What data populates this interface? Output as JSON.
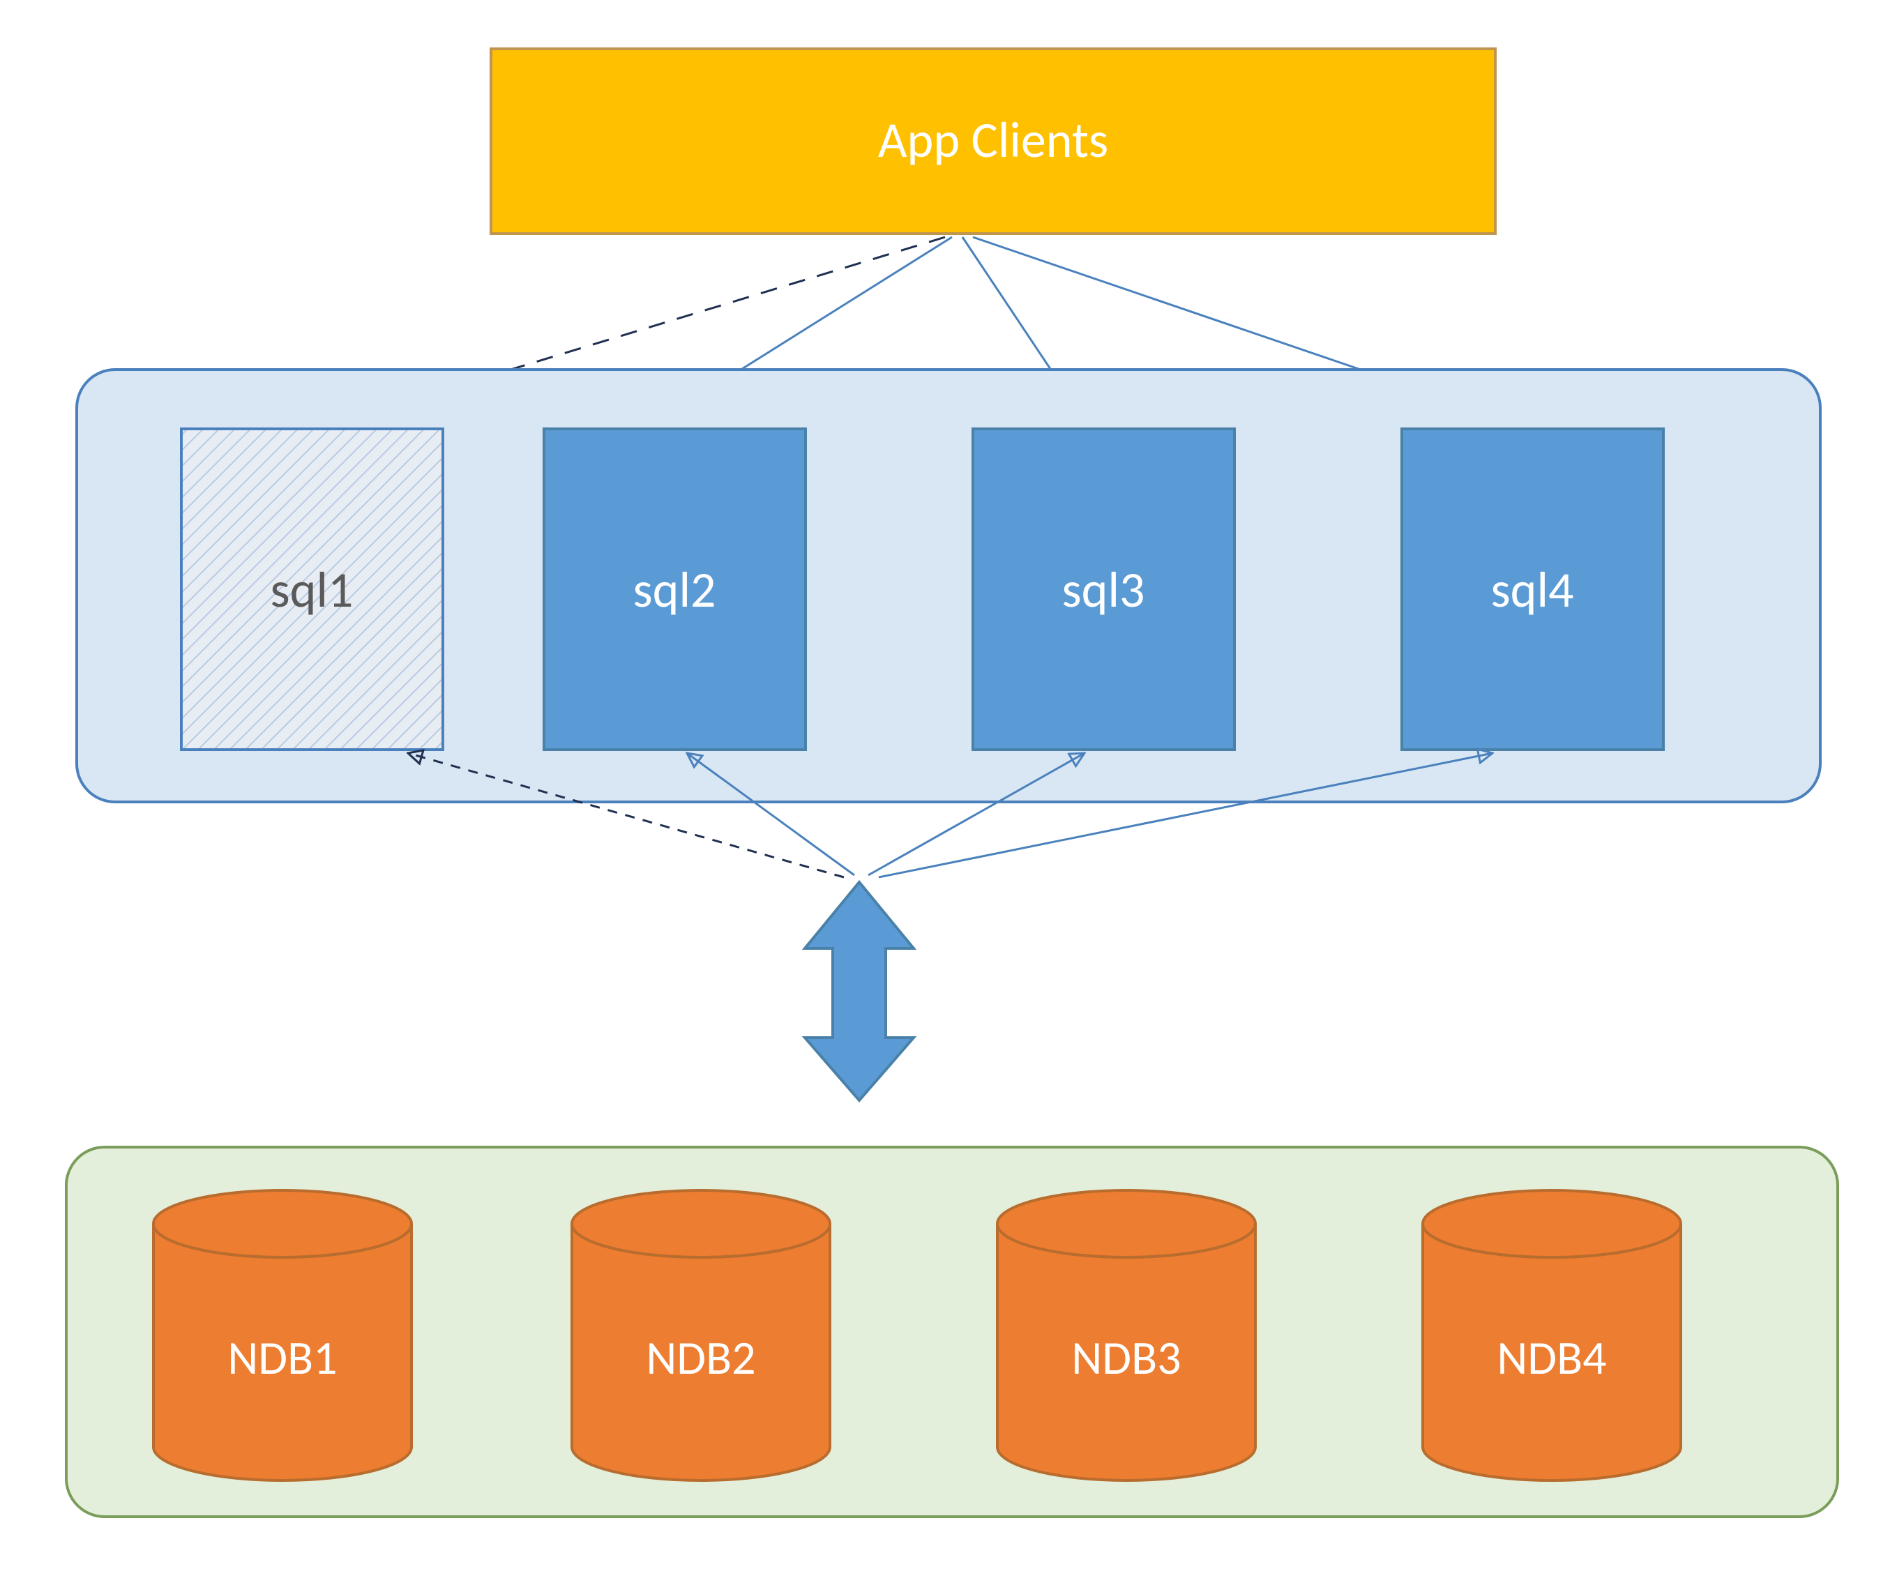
{
  "colors": {
    "yellow_fill": "#ffc000",
    "yellow_stroke": "#c0954d",
    "blue_container_fill": "#d9e6f4",
    "blue_container_stroke": "#4a81bd",
    "blue_node_fill": "#5b9bd5",
    "blue_node_stroke": "#4a81a8",
    "green_container_fill": "#e4efdb",
    "green_container_stroke": "#7a9d5a",
    "orange_fill": "#ed7d31",
    "orange_stroke": "#b86c2e",
    "line_blue": "#4a81bd",
    "dash_dark": "#203050",
    "hatch_fill": "#e8edf3",
    "hatch_stroke": "#b8cbe2"
  },
  "top": {
    "label": "App Clients"
  },
  "sql": {
    "nodes": [
      {
        "id": "sql1",
        "label": "sql1",
        "hatched": true
      },
      {
        "id": "sql2",
        "label": "sql2",
        "hatched": false
      },
      {
        "id": "sql3",
        "label": "sql3",
        "hatched": false
      },
      {
        "id": "sql4",
        "label": "sql4",
        "hatched": false
      }
    ]
  },
  "ndb": {
    "nodes": [
      {
        "id": "ndb1",
        "label": "NDB1"
      },
      {
        "id": "ndb2",
        "label": "NDB2"
      },
      {
        "id": "ndb3",
        "label": "NDB3"
      },
      {
        "id": "ndb4",
        "label": "NDB4"
      }
    ]
  }
}
